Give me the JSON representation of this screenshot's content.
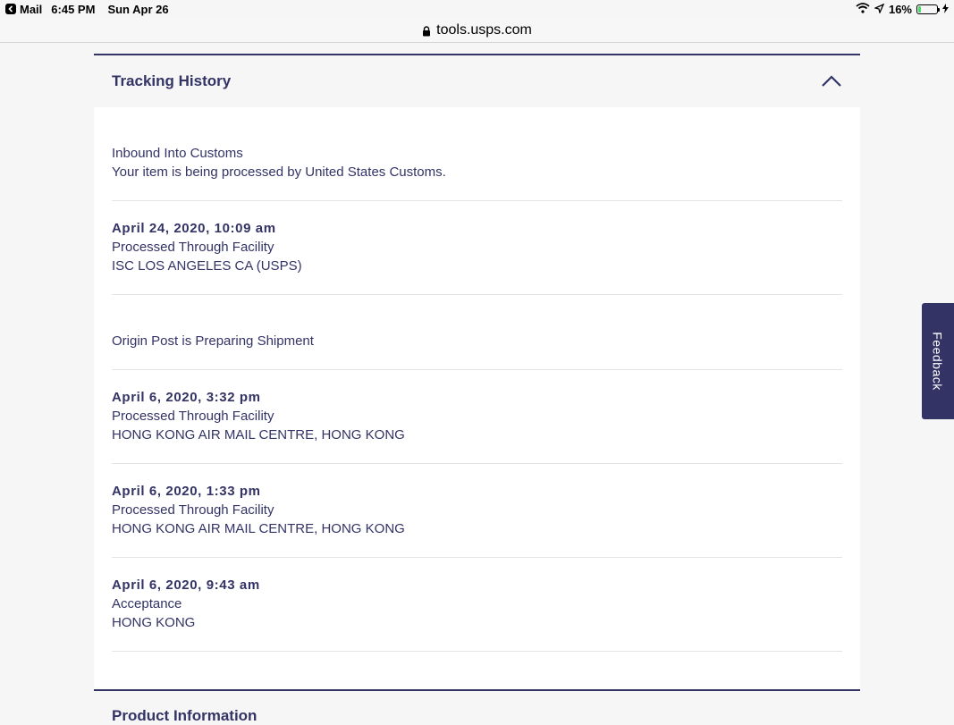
{
  "status_bar": {
    "back_app": "Mail",
    "time": "6:45 PM",
    "date": "Sun Apr 26",
    "battery": "16%",
    "battery_level": 0.16
  },
  "browser": {
    "url": "tools.usps.com"
  },
  "tracking_history": {
    "title": "Tracking History",
    "events": [
      {
        "date": "",
        "status": "Inbound Into Customs",
        "detail": "Your item is being processed by United States Customs."
      },
      {
        "date": "April 24, 2020, 10:09 am",
        "status": "Processed Through Facility",
        "detail": "ISC LOS ANGELES CA (USPS)"
      },
      {
        "date": "",
        "status": "Origin Post is Preparing Shipment",
        "detail": ""
      },
      {
        "date": "April 6, 2020, 3:32 pm",
        "status": "Processed Through Facility",
        "detail": "HONG KONG AIR MAIL CENTRE, HONG KONG"
      },
      {
        "date": "April 6, 2020, 1:33 pm",
        "status": "Processed Through Facility",
        "detail": "HONG KONG AIR MAIL CENTRE, HONG KONG"
      },
      {
        "date": "April 6, 2020, 9:43 am",
        "status": "Acceptance",
        "detail": "HONG KONG"
      }
    ]
  },
  "next_section": {
    "title": "Product Information"
  },
  "feedback": {
    "label": "Feedback"
  },
  "colors": {
    "brand": "#333366",
    "battery_fill": "#4cd964"
  }
}
